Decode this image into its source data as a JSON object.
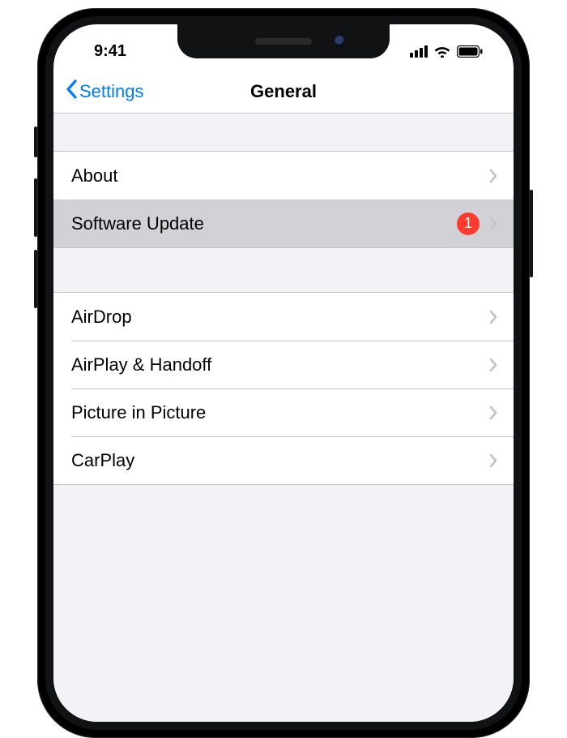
{
  "status": {
    "time": "9:41"
  },
  "nav": {
    "back_label": "Settings",
    "title": "General"
  },
  "groups": [
    {
      "rows": [
        {
          "id": "about",
          "label": "About",
          "badge": null,
          "selected": false
        },
        {
          "id": "software-update",
          "label": "Software Update",
          "badge": "1",
          "selected": true
        }
      ]
    },
    {
      "rows": [
        {
          "id": "airdrop",
          "label": "AirDrop",
          "badge": null,
          "selected": false
        },
        {
          "id": "airplay-handoff",
          "label": "AirPlay & Handoff",
          "badge": null,
          "selected": false
        },
        {
          "id": "pip",
          "label": "Picture in Picture",
          "badge": null,
          "selected": false
        },
        {
          "id": "carplay",
          "label": "CarPlay",
          "badge": null,
          "selected": false
        }
      ]
    }
  ],
  "colors": {
    "tint": "#007aff",
    "badge": "#ff3b30",
    "group_bg": "#f2f2f7",
    "separator": "#c6c6c8",
    "selected_row": "#d1d1d6"
  }
}
